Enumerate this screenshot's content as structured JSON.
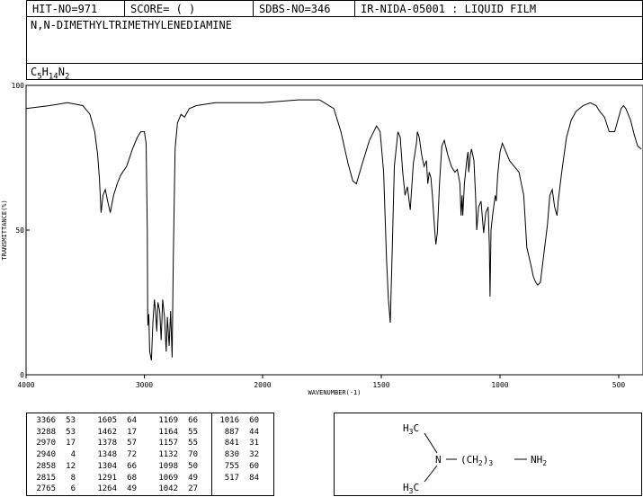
{
  "header": {
    "hit_no": "HIT-NO=971",
    "score": "SCORE=  (   )",
    "sdbs_no": "SDBS-NO=346",
    "method": "IR-NIDA-05001 : LIQUID FILM"
  },
  "compound": {
    "name": "N,N-DIMETHYLTRIMETHYLENEDIAMINE",
    "formula_parts": [
      "C",
      "5",
      "H",
      "14",
      "N",
      "2"
    ]
  },
  "chart_data": {
    "type": "line",
    "xlabel": "WAVENUMBER(-1)",
    "ylabel": "TRANSMITTANCE(%)",
    "xlim": [
      4000,
      400
    ],
    "ylim": [
      0,
      100
    ],
    "x_ticks": [
      4000,
      3000,
      2000,
      1500,
      1000,
      500
    ],
    "y_ticks": [
      0,
      50,
      100
    ],
    "series": [
      {
        "points": [
          [
            4000,
            92
          ],
          [
            3800,
            93
          ],
          [
            3650,
            94
          ],
          [
            3520,
            93
          ],
          [
            3460,
            90
          ],
          [
            3420,
            84
          ],
          [
            3395,
            76
          ],
          [
            3380,
            68
          ],
          [
            3366,
            56
          ],
          [
            3350,
            62
          ],
          [
            3330,
            64
          ],
          [
            3310,
            60
          ],
          [
            3288,
            56
          ],
          [
            3260,
            62
          ],
          [
            3230,
            66
          ],
          [
            3200,
            69
          ],
          [
            3150,
            72
          ],
          [
            3100,
            78
          ],
          [
            3060,
            82
          ],
          [
            3030,
            84
          ],
          [
            3000,
            84
          ],
          [
            2985,
            80
          ],
          [
            2975,
            50
          ],
          [
            2972,
            22
          ],
          [
            2970,
            17
          ],
          [
            2962,
            21
          ],
          [
            2955,
            8
          ],
          [
            2940,
            5
          ],
          [
            2928,
            18
          ],
          [
            2915,
            26
          ],
          [
            2905,
            22
          ],
          [
            2895,
            15
          ],
          [
            2885,
            25
          ],
          [
            2870,
            22
          ],
          [
            2858,
            12
          ],
          [
            2845,
            26
          ],
          [
            2830,
            20
          ],
          [
            2815,
            8
          ],
          [
            2805,
            20
          ],
          [
            2790,
            10
          ],
          [
            2778,
            22
          ],
          [
            2765,
            6
          ],
          [
            2755,
            40
          ],
          [
            2740,
            78
          ],
          [
            2720,
            87
          ],
          [
            2690,
            90
          ],
          [
            2660,
            89
          ],
          [
            2620,
            92
          ],
          [
            2560,
            93
          ],
          [
            2400,
            94
          ],
          [
            2200,
            94
          ],
          [
            2000,
            94
          ],
          [
            1850,
            95
          ],
          [
            1760,
            95
          ],
          [
            1700,
            92
          ],
          [
            1670,
            84
          ],
          [
            1640,
            73
          ],
          [
            1620,
            67
          ],
          [
            1605,
            66
          ],
          [
            1580,
            73
          ],
          [
            1550,
            81
          ],
          [
            1520,
            86
          ],
          [
            1505,
            84
          ],
          [
            1490,
            70
          ],
          [
            1478,
            40
          ],
          [
            1470,
            26
          ],
          [
            1462,
            18
          ],
          [
            1455,
            40
          ],
          [
            1445,
            72
          ],
          [
            1430,
            84
          ],
          [
            1420,
            82
          ],
          [
            1410,
            70
          ],
          [
            1400,
            62
          ],
          [
            1390,
            65
          ],
          [
            1378,
            57
          ],
          [
            1365,
            73
          ],
          [
            1352,
            80
          ],
          [
            1348,
            84
          ],
          [
            1340,
            82
          ],
          [
            1330,
            76
          ],
          [
            1320,
            72
          ],
          [
            1310,
            74
          ],
          [
            1304,
            66
          ],
          [
            1298,
            70
          ],
          [
            1291,
            68
          ],
          [
            1285,
            62
          ],
          [
            1275,
            50
          ],
          [
            1270,
            45
          ],
          [
            1264,
            49
          ],
          [
            1255,
            66
          ],
          [
            1245,
            79
          ],
          [
            1235,
            81
          ],
          [
            1220,
            76
          ],
          [
            1205,
            72
          ],
          [
            1190,
            70
          ],
          [
            1180,
            71
          ],
          [
            1169,
            66
          ],
          [
            1164,
            55
          ],
          [
            1160,
            62
          ],
          [
            1157,
            55
          ],
          [
            1150,
            66
          ],
          [
            1140,
            74
          ],
          [
            1135,
            77
          ],
          [
            1132,
            70
          ],
          [
            1125,
            76
          ],
          [
            1120,
            78
          ],
          [
            1110,
            74
          ],
          [
            1103,
            62
          ],
          [
            1098,
            50
          ],
          [
            1090,
            58
          ],
          [
            1080,
            60
          ],
          [
            1069,
            49
          ],
          [
            1060,
            56
          ],
          [
            1050,
            58
          ],
          [
            1045,
            45
          ],
          [
            1042,
            27
          ],
          [
            1038,
            50
          ],
          [
            1030,
            56
          ],
          [
            1020,
            62
          ],
          [
            1016,
            60
          ],
          [
            1010,
            69
          ],
          [
            1000,
            77
          ],
          [
            990,
            80
          ],
          [
            980,
            78
          ],
          [
            960,
            74
          ],
          [
            940,
            72
          ],
          [
            920,
            70
          ],
          [
            900,
            62
          ],
          [
            887,
            44
          ],
          [
            870,
            38
          ],
          [
            860,
            34
          ],
          [
            850,
            32
          ],
          [
            841,
            31
          ],
          [
            830,
            32
          ],
          [
            800,
            52
          ],
          [
            790,
            62
          ],
          [
            780,
            64
          ],
          [
            770,
            58
          ],
          [
            760,
            55
          ],
          [
            755,
            60
          ],
          [
            740,
            70
          ],
          [
            720,
            82
          ],
          [
            700,
            88
          ],
          [
            680,
            91
          ],
          [
            650,
            93
          ],
          [
            620,
            94
          ],
          [
            595,
            93
          ],
          [
            580,
            91
          ],
          [
            560,
            89
          ],
          [
            540,
            84
          ],
          [
            517,
            84
          ],
          [
            500,
            89
          ],
          [
            490,
            92
          ],
          [
            480,
            93
          ],
          [
            470,
            92
          ],
          [
            450,
            88
          ],
          [
            435,
            83
          ],
          [
            420,
            79
          ],
          [
            405,
            78
          ]
        ]
      }
    ]
  },
  "peak_table": {
    "columns": [
      [
        [
          "3366",
          "53"
        ],
        [
          "3288",
          "53"
        ],
        [
          "2970",
          "17"
        ],
        [
          "2940",
          "4"
        ],
        [
          "2858",
          "12"
        ],
        [
          "2815",
          "8"
        ],
        [
          "2765",
          "6"
        ]
      ],
      [
        [
          "1605",
          "64"
        ],
        [
          "1462",
          "17"
        ],
        [
          "1378",
          "57"
        ],
        [
          "1348",
          "72"
        ],
        [
          "1304",
          "66"
        ],
        [
          "1291",
          "68"
        ],
        [
          "1264",
          "49"
        ]
      ],
      [
        [
          "1169",
          "66"
        ],
        [
          "1164",
          "55"
        ],
        [
          "1157",
          "55"
        ],
        [
          "1132",
          "70"
        ],
        [
          "1098",
          "50"
        ],
        [
          "1069",
          "49"
        ],
        [
          "1042",
          "27"
        ]
      ],
      [
        [
          "1016",
          "60"
        ],
        [
          "887",
          "44"
        ],
        [
          "841",
          "31"
        ],
        [
          "830",
          "32"
        ],
        [
          "755",
          "60"
        ],
        [
          "517",
          "84"
        ]
      ]
    ]
  },
  "structure": {
    "methyl_top": [
      "H",
      "3",
      "C"
    ],
    "methyl_bottom": [
      "H",
      "3",
      "C"
    ],
    "nitrogen": "N",
    "chain": [
      "(CH",
      "2",
      ")",
      "3"
    ],
    "amine": [
      "NH",
      "2"
    ]
  }
}
